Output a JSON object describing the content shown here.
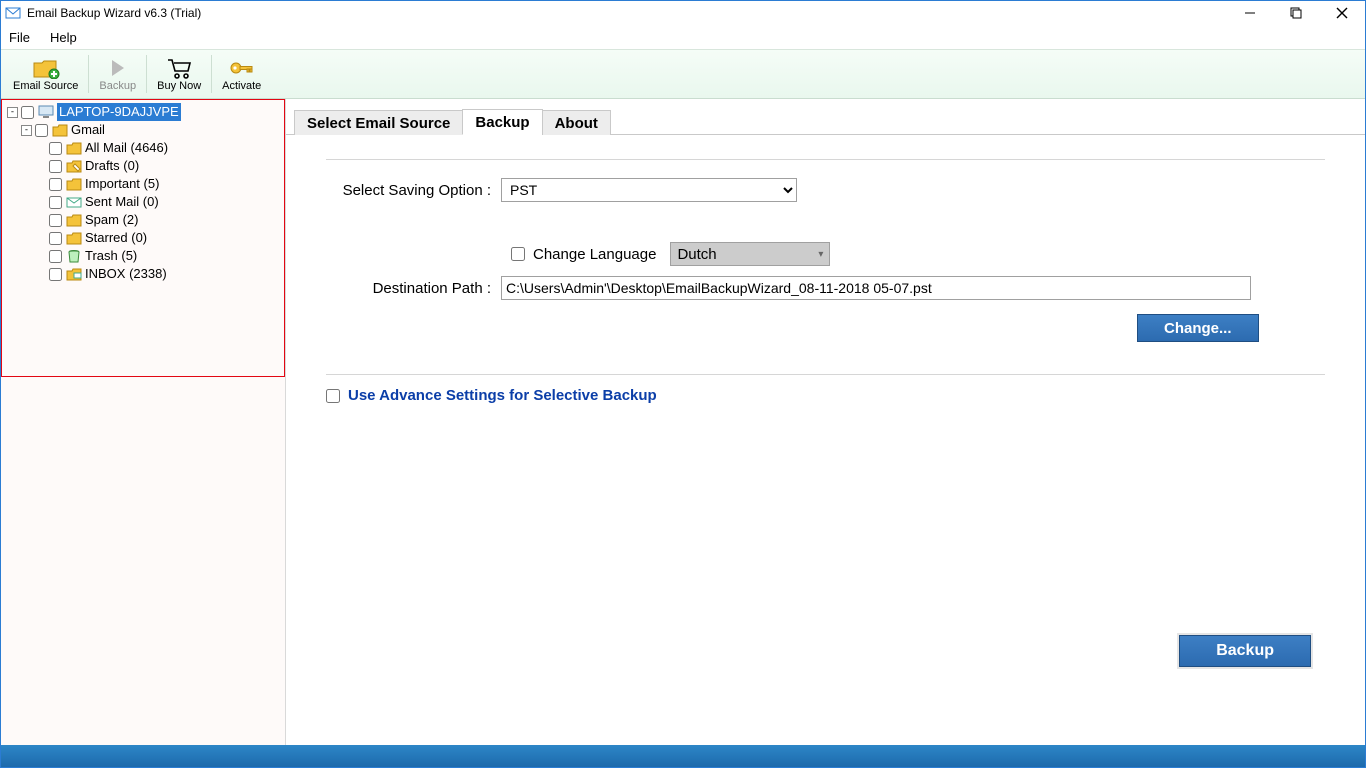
{
  "window": {
    "title": "Email Backup Wizard v6.3 (Trial)"
  },
  "menubar": {
    "file": "File",
    "help": "Help"
  },
  "toolbar": {
    "email_source": "Email Source",
    "backup": "Backup",
    "buy_now": "Buy Now",
    "activate": "Activate"
  },
  "tree": {
    "root": "LAPTOP-9DAJJVPE",
    "account": "Gmail",
    "folders": [
      "All Mail (4646)",
      "Drafts (0)",
      "Important (5)",
      "Sent Mail (0)",
      "Spam (2)",
      "Starred (0)",
      "Trash (5)",
      "INBOX (2338)"
    ]
  },
  "tabs": {
    "select_source": "Select Email Source",
    "backup": "Backup",
    "about": "About"
  },
  "form": {
    "saving_option_label": "Select Saving Option :",
    "saving_option_value": "PST",
    "change_language_label": "Change Language",
    "language_value": "Dutch",
    "destination_label": "Destination Path :",
    "destination_value": "C:\\Users\\Admin'\\Desktop\\EmailBackupWizard_08-11-2018 05-07.pst",
    "change_btn": "Change...",
    "advance_label": "Use Advance Settings for Selective Backup",
    "backup_btn": "Backup"
  }
}
